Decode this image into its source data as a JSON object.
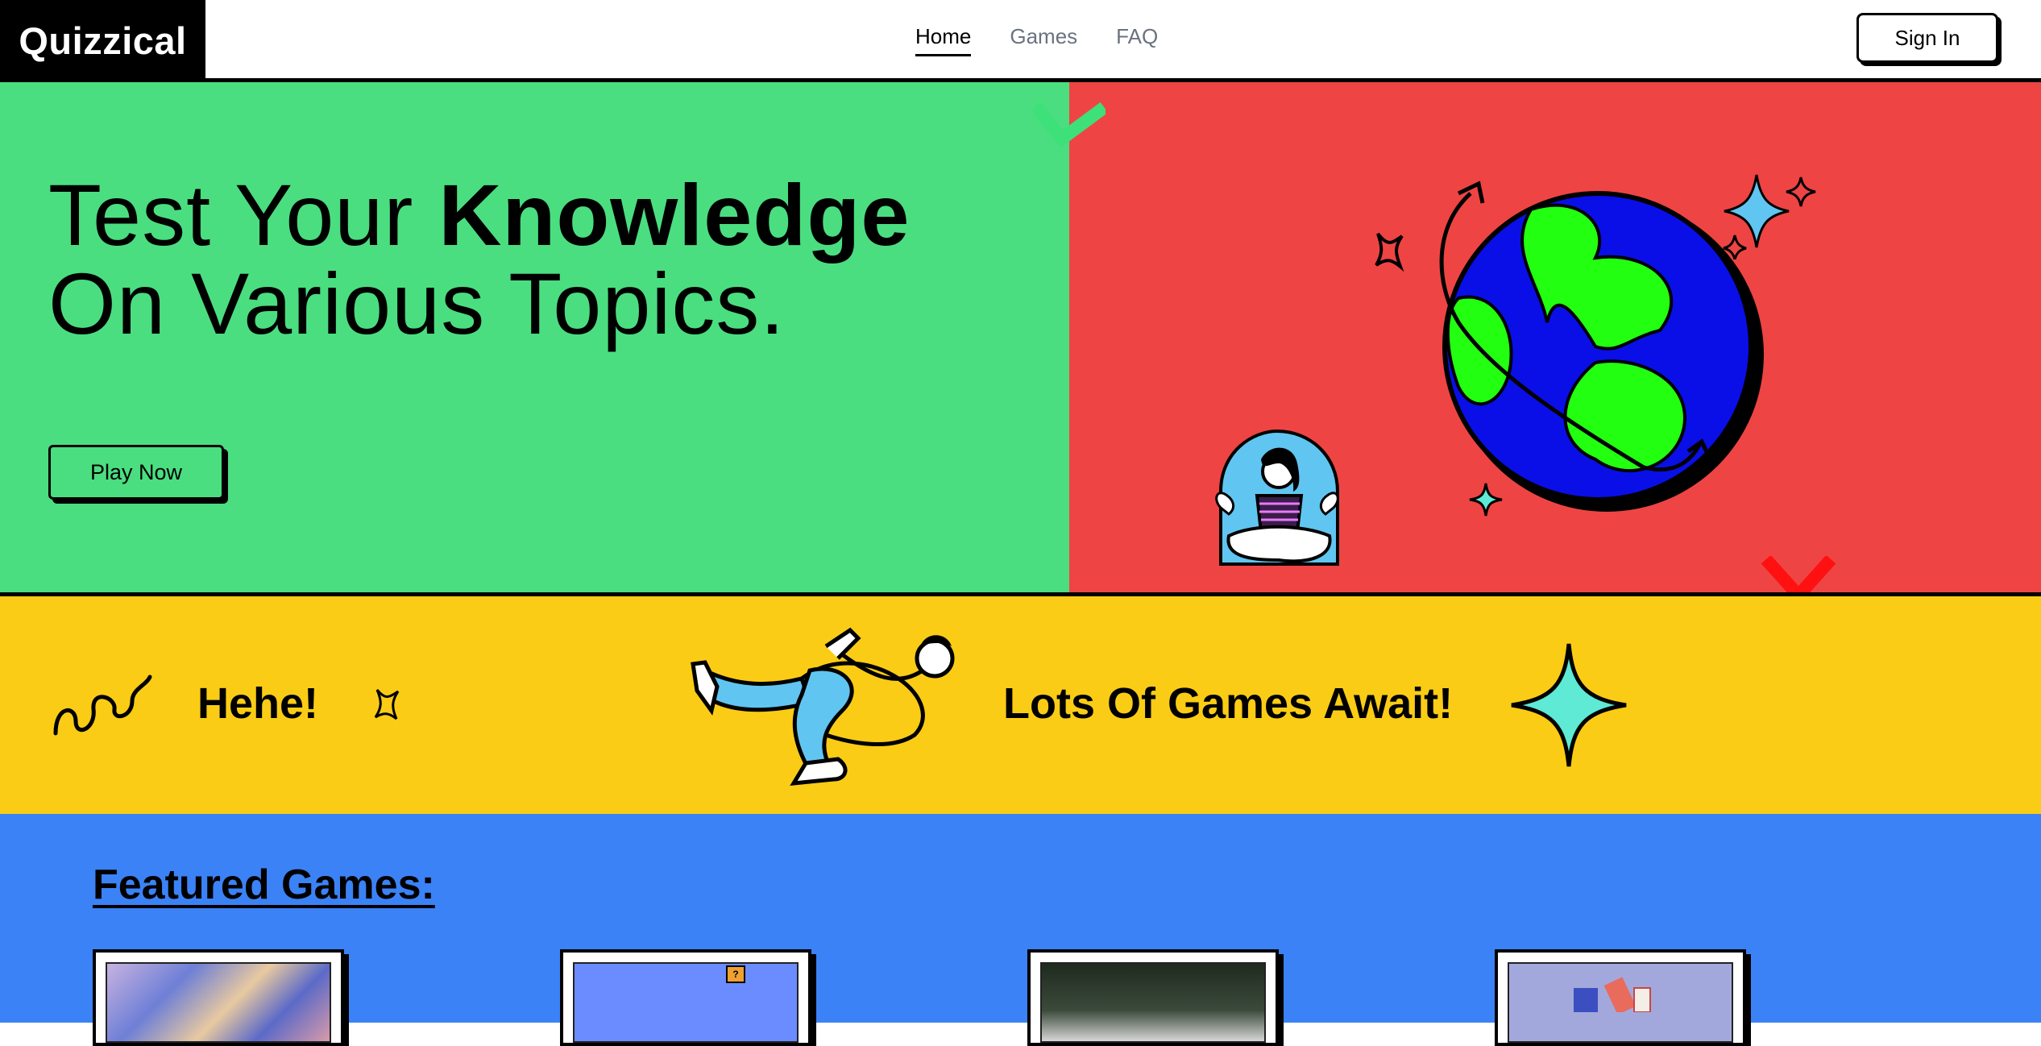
{
  "brand": {
    "name": "Quizzical"
  },
  "nav": {
    "items": [
      {
        "label": "Home",
        "active": true
      },
      {
        "label": "Games",
        "active": false
      },
      {
        "label": "FAQ",
        "active": false
      }
    ],
    "sign_in": "Sign In"
  },
  "hero": {
    "title_prefix": "Test Your ",
    "title_bold": "Knowledge",
    "title_line2": "On Various Topics.",
    "cta": "Play Now"
  },
  "band": {
    "hehe": "Hehe!",
    "tagline": "Lots Of Games Await!"
  },
  "featured": {
    "heading": "Featured Games:",
    "thumbs": [
      "abstract-painting",
      "quiz-block",
      "crowd-photo",
      "books-illustration"
    ]
  },
  "colors": {
    "green": "#4ade80",
    "red": "#ef4444",
    "yellow": "#facc15",
    "blue": "#3b82f6",
    "black": "#000000"
  }
}
